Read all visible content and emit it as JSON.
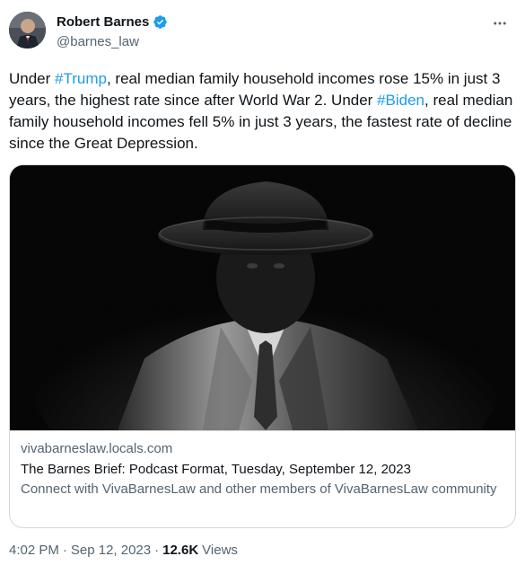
{
  "author": {
    "name": "Robert Barnes",
    "handle": "@barnes_law",
    "verified": true,
    "verified_color": "#1d9bf0"
  },
  "tweet": {
    "segments": [
      {
        "text": "Under ",
        "tag": false
      },
      {
        "text": "#Trump",
        "tag": true
      },
      {
        "text": ", real median family household incomes rose 15% in just 3 years, the highest rate since after World War 2. Under ",
        "tag": false
      },
      {
        "text": "#Biden",
        "tag": true
      },
      {
        "text": ", real median family household incomes fell 5% in just 3 years, the fastest rate of decline since the Great Depression.",
        "tag": false
      }
    ]
  },
  "card": {
    "domain": "vivabarneslaw.locals.com",
    "title": "The Barnes Brief: Podcast Format, Tuesday, September 12, 2023",
    "description": "Connect with VivaBarnesLaw and other members of VivaBarnesLaw community"
  },
  "meta": {
    "time": "4:02 PM",
    "separator": "·",
    "date": "Sep 12, 2023",
    "views_count": "12.6K",
    "views_label": "Views"
  },
  "icons": {
    "more": "more-dots-icon",
    "verified": "verified-badge-icon"
  },
  "colors": {
    "link": "#1d9bf0",
    "text": "#0f1419",
    "secondary": "#536471",
    "border": "#cfd9de"
  }
}
